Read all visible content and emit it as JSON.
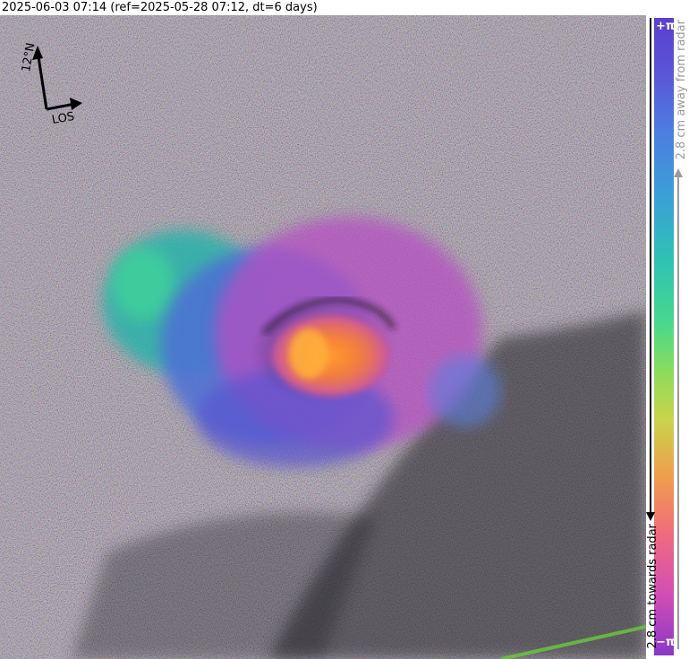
{
  "title": "2025-06-03 07:14 (ref=2025-05-28 07:12, dt=6 days)",
  "compass": {
    "north_label": "12°N",
    "los_label": "LOS"
  },
  "colorbar": {
    "top_label": "+π",
    "bottom_label": "−π",
    "away_label": "2.8 cm away from radar",
    "towards_label": "2.8 cm towards radar",
    "colors": [
      "#5b3fd0",
      "#4d7ee0",
      "#2fc2b4",
      "#48d98b",
      "#c9d44a",
      "#ef9e4c",
      "#f06b7d",
      "#d44fb3",
      "#8a38c8"
    ]
  }
}
